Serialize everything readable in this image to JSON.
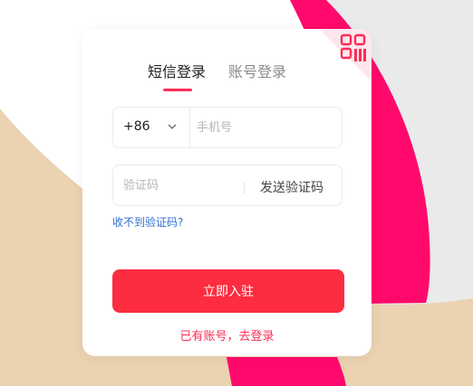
{
  "tabs": [
    {
      "label": "短信登录",
      "active": true
    },
    {
      "label": "账号登录",
      "active": false
    }
  ],
  "phone": {
    "country_code": "+86",
    "placeholder": "手机号",
    "value": ""
  },
  "verification": {
    "placeholder": "验证码",
    "value": "",
    "send_label": "发送验证码"
  },
  "no_code_link": "收不到验证码?",
  "submit_label": "立即入驻",
  "login_link": "已有账号，去登录",
  "icons": {
    "qr_corner": "qr-code-icon",
    "country_dropdown": "chevron-down-icon"
  },
  "colors": {
    "accent": "#fe2c55",
    "button": "#fe2c40",
    "link": "#2e6fd1",
    "bg_beige": "#ebd2b1",
    "bg_pink": "#ff0a6c",
    "bg_gray": "#eaeaea"
  }
}
